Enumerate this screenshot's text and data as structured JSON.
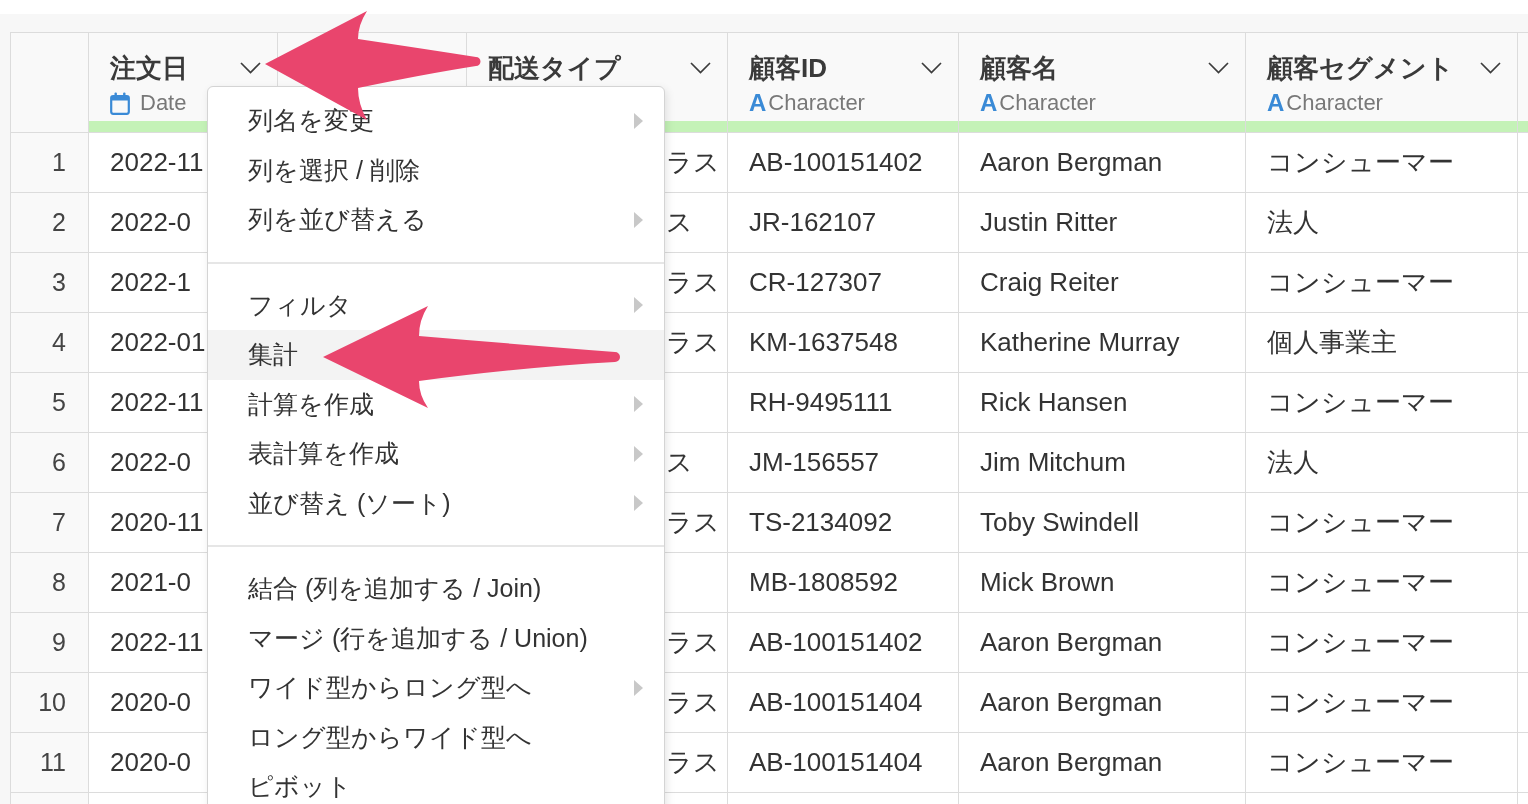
{
  "table": {
    "columns": [
      {
        "name": "注文日",
        "type": {
          "kind": "date",
          "label": "Date"
        }
      },
      {
        "name": "配送タイプ"
      },
      {
        "name": "顧客ID",
        "type": {
          "kind": "character",
          "glyph": "A",
          "label": "Character"
        }
      },
      {
        "name": "顧客名",
        "type": {
          "kind": "character",
          "glyph": "A",
          "label": "Character"
        }
      },
      {
        "name": "顧客セグメント",
        "type": {
          "kind": "character",
          "glyph": "A",
          "label": "Character"
        }
      }
    ],
    "rows": [
      {
        "number": "1",
        "order_date": "2022-11",
        "shipping_type": "ラス",
        "customer_id": "AB-100151402",
        "customer_name": "Aaron Bergman",
        "customer_segment": "コンシューマー"
      },
      {
        "number": "2",
        "order_date": "2022-0",
        "shipping_type": "ス",
        "customer_id": "JR-162107",
        "customer_name": "Justin Ritter",
        "customer_segment": "法人"
      },
      {
        "number": "3",
        "order_date": "2022-1",
        "shipping_type": "ラス",
        "customer_id": "CR-127307",
        "customer_name": "Craig Reiter",
        "customer_segment": "コンシューマー"
      },
      {
        "number": "4",
        "order_date": "2022-01",
        "shipping_type": "ラス",
        "customer_id": "KM-1637548",
        "customer_name": "Katherine Murray",
        "customer_segment": "個人事業主"
      },
      {
        "number": "5",
        "order_date": "2022-11",
        "customer_id": "RH-9495111",
        "customer_name": "Rick Hansen",
        "customer_segment": "コンシューマー"
      },
      {
        "number": "6",
        "order_date": "2022-0",
        "shipping_type": "ス",
        "customer_id": "JM-156557",
        "customer_name": "Jim Mitchum",
        "customer_segment": "法人"
      },
      {
        "number": "7",
        "order_date": "2020-11",
        "shipping_type": "ラス",
        "customer_id": "TS-2134092",
        "customer_name": "Toby Swindell",
        "customer_segment": "コンシューマー"
      },
      {
        "number": "8",
        "order_date": "2021-0",
        "customer_id": "MB-1808592",
        "customer_name": "Mick Brown",
        "customer_segment": "コンシューマー"
      },
      {
        "number": "9",
        "order_date": "2022-11",
        "shipping_type": "ラス",
        "customer_id": "AB-100151402",
        "customer_name": "Aaron Bergman",
        "customer_segment": "コンシューマー"
      },
      {
        "number": "10",
        "order_date": "2020-0",
        "shipping_type": "ラス",
        "customer_id": "AB-100151404",
        "customer_name": "Aaron Bergman",
        "customer_segment": "コンシューマー"
      },
      {
        "number": "11",
        "order_date": "2020-0",
        "shipping_type": "ラス",
        "customer_id": "AB-100151404",
        "customer_name": "Aaron Bergman",
        "customer_segment": "コンシューマー"
      }
    ]
  },
  "context_menu": {
    "items": [
      {
        "kind": "item",
        "label": "列名を変更",
        "submenu": true,
        "selected": false
      },
      {
        "kind": "item",
        "label": "列を選択 / 削除",
        "submenu": false,
        "selected": false
      },
      {
        "kind": "item",
        "label": "列を並び替える",
        "submenu": true,
        "selected": false
      },
      {
        "kind": "separator"
      },
      {
        "kind": "item",
        "label": "フィルタ",
        "submenu": true,
        "selected": false
      },
      {
        "kind": "item",
        "label": "集計",
        "submenu": false,
        "selected": true
      },
      {
        "kind": "item",
        "label": "計算を作成",
        "submenu": true,
        "selected": false
      },
      {
        "kind": "item",
        "label": "表計算を作成",
        "submenu": true,
        "selected": false
      },
      {
        "kind": "item",
        "label": "並び替え (ソート)",
        "submenu": true,
        "selected": false
      },
      {
        "kind": "separator"
      },
      {
        "kind": "item",
        "label": "結合 (列を追加する / Join)",
        "submenu": false,
        "selected": false
      },
      {
        "kind": "item",
        "label": "マージ (行を追加する / Union)",
        "submenu": false,
        "selected": false
      },
      {
        "kind": "item",
        "label": "ワイド型からロング型へ",
        "submenu": true,
        "selected": false
      },
      {
        "kind": "item",
        "label": "ロング型からワイド型へ",
        "submenu": false,
        "selected": false
      },
      {
        "kind": "item",
        "label": "ピボット",
        "submenu": false,
        "selected": false
      }
    ]
  }
}
